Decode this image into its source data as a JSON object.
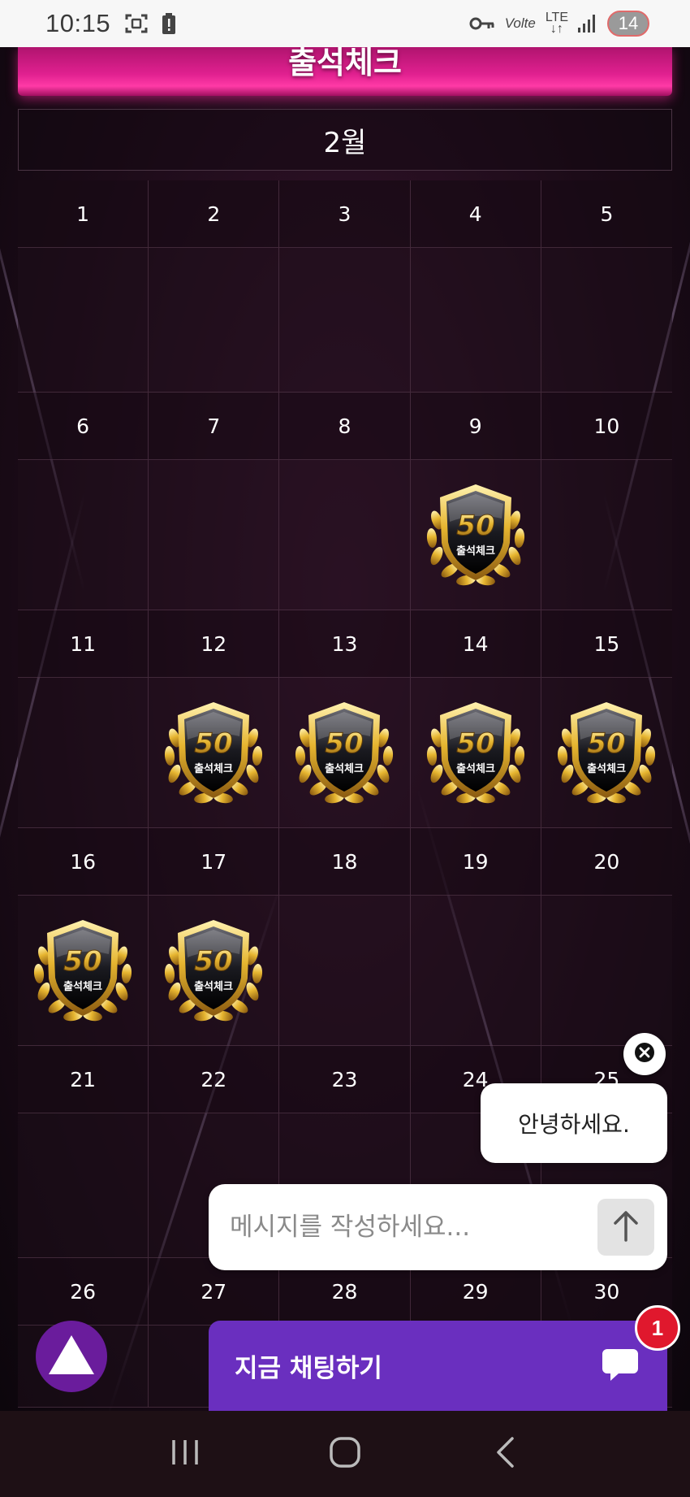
{
  "status_bar": {
    "time": "10:15",
    "volte": "Volte",
    "lte": "LTE",
    "battery": "14"
  },
  "page": {
    "title": "출석체크",
    "month": "2월"
  },
  "badge": {
    "value": "50",
    "label": "출석체크"
  },
  "calendar": {
    "rows": [
      [
        {
          "day": "1",
          "stamp": false
        },
        {
          "day": "2",
          "stamp": false
        },
        {
          "day": "3",
          "stamp": false
        },
        {
          "day": "4",
          "stamp": false
        },
        {
          "day": "5",
          "stamp": false
        }
      ],
      [
        {
          "day": "6",
          "stamp": false
        },
        {
          "day": "7",
          "stamp": false
        },
        {
          "day": "8",
          "stamp": false
        },
        {
          "day": "9",
          "stamp": true
        },
        {
          "day": "10",
          "stamp": false
        }
      ],
      [
        {
          "day": "11",
          "stamp": false
        },
        {
          "day": "12",
          "stamp": true
        },
        {
          "day": "13",
          "stamp": true
        },
        {
          "day": "14",
          "stamp": true
        },
        {
          "day": "15",
          "stamp": true
        }
      ],
      [
        {
          "day": "16",
          "stamp": true
        },
        {
          "day": "17",
          "stamp": true
        },
        {
          "day": "18",
          "stamp": false
        },
        {
          "day": "19",
          "stamp": false
        },
        {
          "day": "20",
          "stamp": false
        }
      ],
      [
        {
          "day": "21",
          "stamp": false
        },
        {
          "day": "22",
          "stamp": false
        },
        {
          "day": "23",
          "stamp": false
        },
        {
          "day": "24",
          "stamp": false
        },
        {
          "day": "25",
          "stamp": false
        }
      ],
      [
        {
          "day": "26",
          "stamp": false
        },
        {
          "day": "27",
          "stamp": false
        },
        {
          "day": "28",
          "stamp": false
        },
        {
          "day": "29",
          "stamp": false
        },
        {
          "day": "30",
          "stamp": false
        }
      ]
    ]
  },
  "chat": {
    "greeting": "안녕하세요.",
    "placeholder": "메시지를 작성하세요...",
    "chat_now_label": "지금 채팅하기",
    "unread_count": "1"
  },
  "colors": {
    "banner": "#e0208f",
    "chat_button": "#6a2fbf",
    "scroll_top": "#6a1c9c",
    "notification": "#e0182d"
  },
  "icons": {
    "status_left": [
      "screenshot-icon",
      "battery-alert-icon"
    ],
    "status_right": [
      "vpn-key-icon",
      "signal-icon"
    ],
    "chat": [
      "close-icon",
      "send-arrow-icon",
      "chat-bubble-icon"
    ],
    "nav": [
      "recents-icon",
      "home-icon",
      "back-icon"
    ],
    "scroll_top": "up-triangle-icon"
  }
}
